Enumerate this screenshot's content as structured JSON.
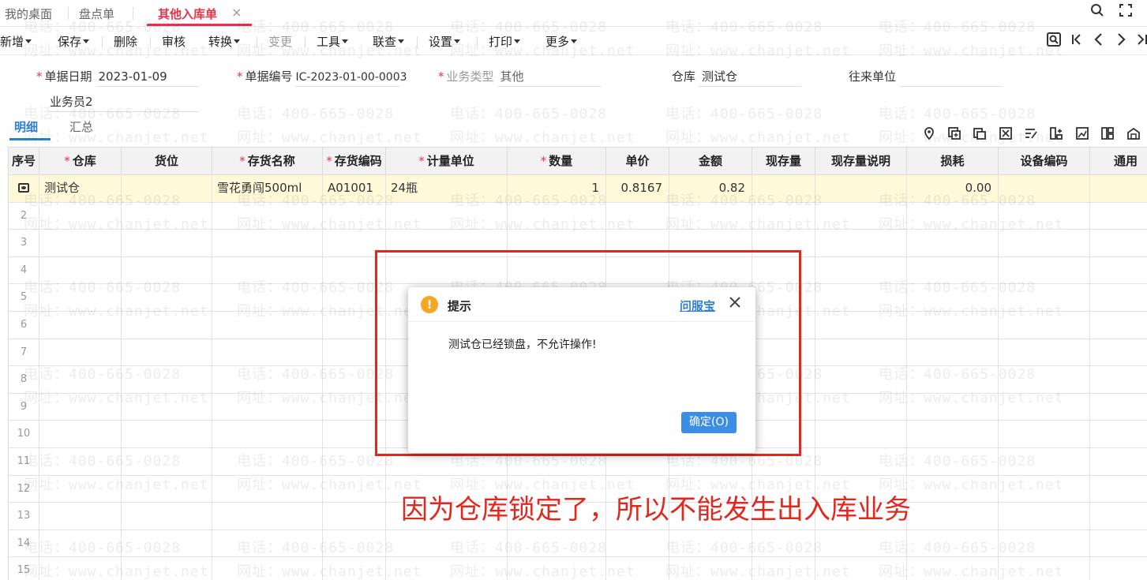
{
  "tabs": {
    "desktop": "我的桌面",
    "stocktake": "盘点单",
    "other_inbound": "其他入库单",
    "close": "×"
  },
  "toolbar": {
    "new": "新增",
    "save": "保存",
    "delete": "删除",
    "approve": "审核",
    "convert": "转换",
    "change": "变更",
    "tools": "工具",
    "query": "联查",
    "settings": "设置",
    "print": "打印",
    "more": "更多"
  },
  "form": {
    "doc_date_label": "单据日期",
    "doc_date_value": "2023-01-09",
    "doc_no_label": "单据编号",
    "doc_no_value": "IC-2023-01-00-0003",
    "biz_type_label": "业务类型",
    "biz_type_value": "其他",
    "warehouse_label": "仓库",
    "warehouse_value": "测试仓",
    "partner_label": "往来单位",
    "partner_value": "",
    "salesman_value": "业务员2",
    "required_mark": "*"
  },
  "detail_tabs": {
    "detail": "明细",
    "summary": "汇总"
  },
  "grid": {
    "columns": [
      {
        "label": "序号",
        "required": false
      },
      {
        "label": "仓库",
        "required": true
      },
      {
        "label": "货位",
        "required": false
      },
      {
        "label": "存货名称",
        "required": true
      },
      {
        "label": "存货编码",
        "required": true
      },
      {
        "label": "计量单位",
        "required": true
      },
      {
        "label": "数量",
        "required": true
      },
      {
        "label": "单价",
        "required": false
      },
      {
        "label": "金额",
        "required": false
      },
      {
        "label": "现存量",
        "required": false
      },
      {
        "label": "现存量说明",
        "required": false
      },
      {
        "label": "损耗",
        "required": false
      },
      {
        "label": "设备编码",
        "required": false
      },
      {
        "label": "通用",
        "required": false
      }
    ],
    "first_row": {
      "warehouse": "测试仓",
      "location": "",
      "item_name": "雪花勇闯500ml",
      "item_code": "A01001",
      "unit": "24瓶",
      "qty": "1",
      "price": "0.8167",
      "amount": "0.82",
      "stock": "",
      "stock_note": "",
      "loss": "0.00",
      "device_code": ""
    },
    "row_numbers": [
      "2",
      "3",
      "4",
      "5",
      "6",
      "7",
      "8",
      "9",
      "10",
      "11",
      "12",
      "13",
      "14",
      "15"
    ]
  },
  "dialog": {
    "title": "提示",
    "link": "问服宝",
    "message": "测试仓已经锁盘，不允许操作!",
    "ok": "确定(O)",
    "warn_glyph": "!"
  },
  "annotation": "因为仓库锁定了，所以不能发生出入库业务",
  "watermark": {
    "phone": "电话：400-665-0028",
    "site": "网址：www.chanjet.net"
  },
  "colors": {
    "accent_red": "#e6334a",
    "link_blue": "#2f7fd6",
    "highlight_row": "#fff8d9",
    "annotation_red": "#e0281f"
  }
}
